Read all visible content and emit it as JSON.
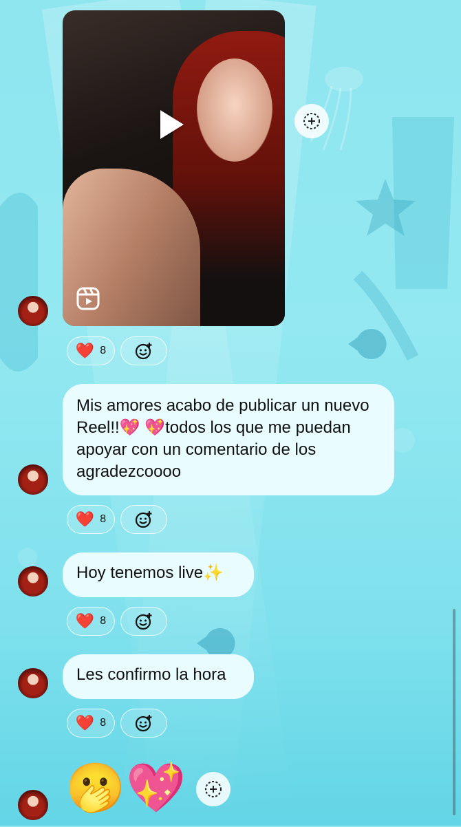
{
  "messages": [
    {
      "type": "reel",
      "reaction_count": "8",
      "heart": "❤️"
    },
    {
      "type": "text",
      "text": "Mis amores acabo de publicar un nuevo Reel!!💖 💖todos los que me puedan apoyar con un comentario de los agradezcoooo",
      "reaction_count": "8",
      "heart": "❤️"
    },
    {
      "type": "text",
      "text": "Hoy tenemos live✨",
      "reaction_count": "8",
      "heart": "❤️"
    },
    {
      "type": "text",
      "text": "Les confirmo la hora",
      "reaction_count": "8",
      "heart": "❤️"
    },
    {
      "type": "emoji",
      "emojis": [
        "🫢",
        "💖"
      ]
    }
  ],
  "icons": {
    "play": "play-icon",
    "reel": "reels-icon",
    "share": "share-icon",
    "add_reaction": "add-reaction-icon"
  },
  "colors": {
    "background": "#8fe6ef",
    "bubble": "#e9fcff",
    "heart": "#e0202e"
  }
}
